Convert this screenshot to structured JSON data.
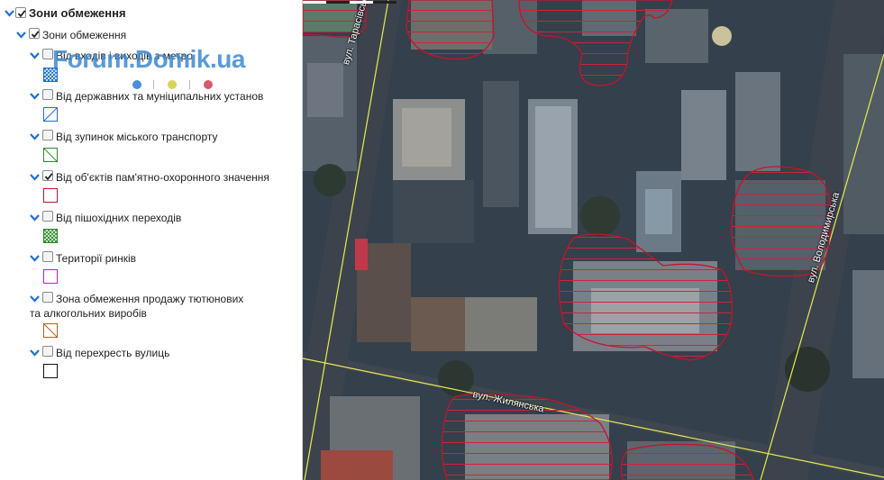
{
  "legend": {
    "root": {
      "label": "Зони обмеження",
      "checked": true
    },
    "group": {
      "label": "Зони обмеження",
      "checked": true
    },
    "items": [
      {
        "label": "Від входів і виходів з метро",
        "checked": false,
        "symbol": "crosshatch",
        "color": "#1f6fd1"
      },
      {
        "label": "Від державних та муніципальних установ",
        "checked": false,
        "symbol": "diagonal",
        "color": "#1f6fd1"
      },
      {
        "label": "Від зупинок міського транспорту",
        "checked": false,
        "symbol": "diagonal-reverse",
        "color": "#2d8a2d"
      },
      {
        "label": "Від об'єктів пам'ятно-охоронного значення",
        "checked": true,
        "symbol": "outline",
        "color": "#c0142a"
      },
      {
        "label": "Від пішохідних переходів",
        "checked": false,
        "symbol": "crosshatch",
        "color": "#2d8a2d"
      },
      {
        "label": "Території ринків",
        "checked": false,
        "symbol": "outline",
        "color": "#c020c8"
      },
      {
        "label": "Зона обмеження продажу тютюнових та алкогольних виробів",
        "checked": false,
        "symbol": "diagonal",
        "color": "#b06418"
      },
      {
        "label": "Від перехресть вулиць",
        "checked": false,
        "symbol": "outline",
        "color": "#111111"
      }
    ]
  },
  "watermark": {
    "text": "Forum.Domik.ua",
    "dot_colors": [
      "#4b8fd6",
      "#d8d45a",
      "#d8586c"
    ]
  },
  "map": {
    "streets": [
      {
        "name": "вул. Тарасівська"
      },
      {
        "name": "вул. Жилянська"
      },
      {
        "name": "вул. Володимирська"
      }
    ],
    "zone_color": "#d0223a",
    "road_line_color": "#e8ec50"
  }
}
